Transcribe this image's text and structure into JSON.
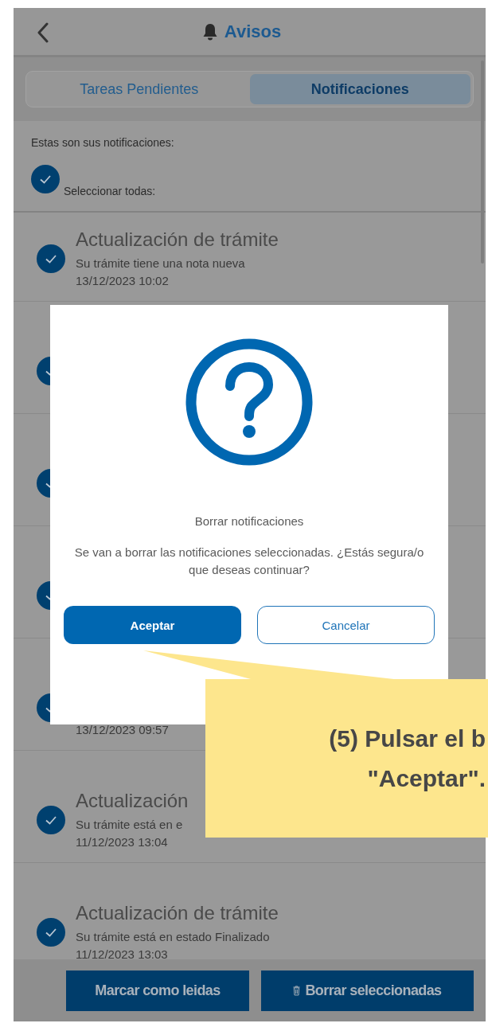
{
  "header": {
    "title": "Avisos"
  },
  "tabs": [
    {
      "label": "Tareas Pendientes",
      "selected": false
    },
    {
      "label": "Notificaciones",
      "selected": true
    }
  ],
  "intro": "Estas son sus notificaciones:",
  "select_all": {
    "label": "Seleccionar todas:",
    "checked": true
  },
  "notifications": [
    {
      "title": "Actualización de trámite",
      "message": "Su trámite tiene una nota nueva",
      "date": "13/12/2023 10:02",
      "checked": true
    },
    {
      "checked": true
    },
    {
      "checked": true
    },
    {
      "checked": true
    },
    {
      "date": "13/12/2023 09:57",
      "checked": true
    },
    {
      "title": "Actualización",
      "message": "Su trámite está en e",
      "date": "11/12/2023 13:04",
      "checked": true
    },
    {
      "title": "Actualización de trámite",
      "message": "Su trámite está en estado Finalizado",
      "date": "11/12/2023 13:03",
      "checked": true
    }
  ],
  "dialog": {
    "title": "Borrar notificaciones",
    "message": "Se van a borrar las notificaciones seleccionadas. ¿Estás segura/o que deseas continuar?",
    "buttons": [
      {
        "label": "Aceptar",
        "kind": "primary"
      },
      {
        "label": "Cancelar",
        "kind": "secondary"
      }
    ]
  },
  "actions": [
    {
      "label": "Marcar como leidas",
      "kind": "plain"
    },
    {
      "label": "Borrar seleccionadas",
      "kind": "delete"
    }
  ],
  "callout": {
    "lines": [
      "(5) Pulsar el b",
      "\"Aceptar\"."
    ]
  }
}
